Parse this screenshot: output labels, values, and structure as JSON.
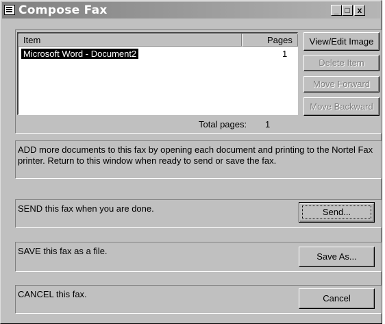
{
  "window": {
    "title": "Compose Fax"
  },
  "titlebar_buttons": {
    "minimize": "_",
    "maximize": "□",
    "close": "x"
  },
  "list": {
    "columns": {
      "item": "Item",
      "pages": "Pages"
    },
    "rows": [
      {
        "item": "Microsoft Word - Document2",
        "pages": "1"
      }
    ]
  },
  "side_buttons": {
    "view_edit": "View/Edit Image",
    "delete": "Delete Item",
    "move_forward": "Move Forward",
    "move_backward": "Move Backward"
  },
  "total": {
    "label": "Total pages:",
    "value": "1"
  },
  "add_info": "ADD more documents to this fax by opening each document and printing to the Nortel Fax printer. Return to this window when ready to send or save the fax.",
  "send": {
    "text": "SEND this fax when you are done.",
    "button": "Send..."
  },
  "save": {
    "text": "SAVE this fax as a file.",
    "button": "Save As..."
  },
  "cancel": {
    "text": "CANCEL this fax.",
    "button": "Cancel"
  }
}
